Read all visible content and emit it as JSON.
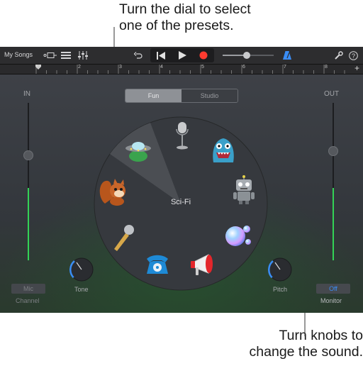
{
  "callouts": {
    "top_line1": "Turn the dial to select",
    "top_line2": "one of the presets.",
    "bottom_line1": "Turn knobs to",
    "bottom_line2": "change the sound."
  },
  "toolbar": {
    "my_songs": "My Songs"
  },
  "ruler": {
    "marks": [
      "1",
      "2",
      "3",
      "4",
      "5",
      "6",
      "7",
      "8"
    ]
  },
  "panel": {
    "in_label": "IN",
    "out_label": "OUT",
    "modes": [
      "Fun",
      "Studio"
    ],
    "selected_mode": "Fun",
    "selected_preset": "Sci-Fi",
    "tone_label": "Tone",
    "pitch_label": "Pitch",
    "mic_label": "Mic",
    "channel_label": "Channel",
    "monitor_state": "Off",
    "monitor_label": "Monitor"
  },
  "presets": [
    "Studio Microphone",
    "Monster",
    "Robot",
    "Bubbles",
    "Megaphone",
    "Telephone",
    "Microphone",
    "Chipmunk",
    "Sci-Fi"
  ],
  "colors": {
    "accent_blue": "#3a8df5",
    "level_green": "#33d356",
    "record_red": "#ff3b30"
  }
}
